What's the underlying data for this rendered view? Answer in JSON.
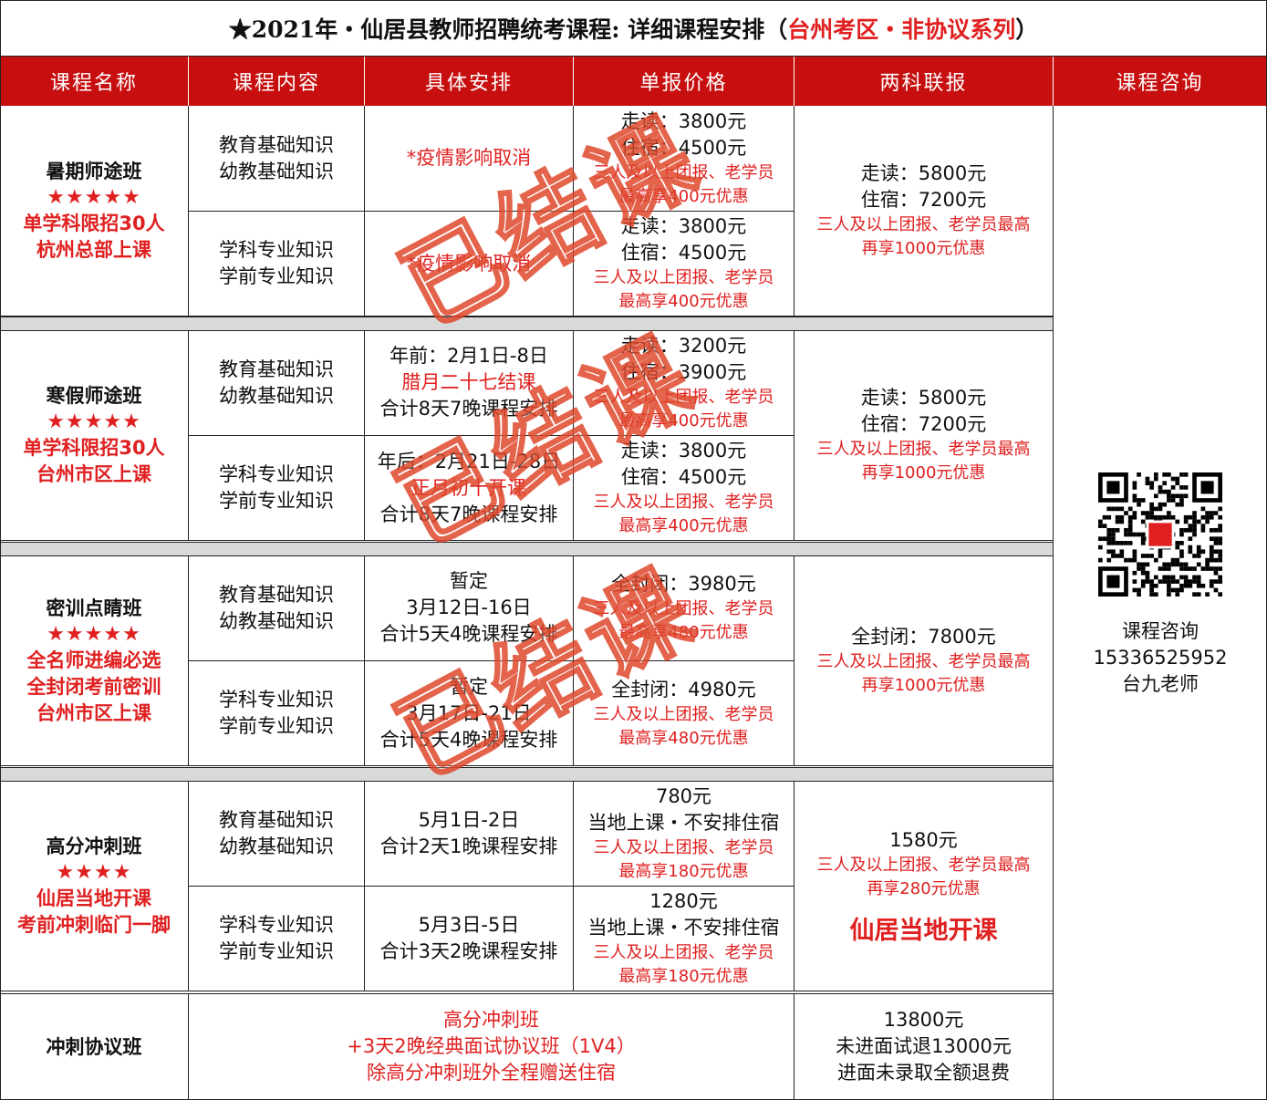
{
  "title": {
    "prefix": "★2021年・仙居县教师招聘统考课程:  详细课程安排（",
    "highlight": "台州考区・非协议系列",
    "suffix": "）"
  },
  "headers": [
    "课程名称",
    "课程内容",
    "具体安排",
    "单报价格",
    "两科联报",
    "课程咨询"
  ],
  "stamp_text": "已结课",
  "sections": [
    {
      "name": "暑期师途班",
      "stars": "★★★★★",
      "notes": [
        "单学科限招30人",
        "杭州总部上课"
      ],
      "rows": [
        {
          "content": [
            "教育基础知识",
            "幼教基础知识"
          ],
          "schedule": [
            {
              "t": "*疫情影响取消",
              "red": true
            }
          ],
          "price": [
            {
              "t": "走读：3800元"
            },
            {
              "t": "住宿：4500元"
            },
            {
              "t": "三人及以上团报、老学员",
              "red": true,
              "sm": true
            },
            {
              "t": "最高享400元优惠",
              "red": true,
              "sm": true
            }
          ]
        },
        {
          "content": [
            "学科专业知识",
            "学前专业知识"
          ],
          "schedule": [
            {
              "t": "*疫情影响取消",
              "red": true
            }
          ],
          "price": [
            {
              "t": "走读：3800元"
            },
            {
              "t": "住宿：4500元"
            },
            {
              "t": "三人及以上团报、老学员",
              "red": true,
              "sm": true
            },
            {
              "t": "最高享400元优惠",
              "red": true,
              "sm": true
            }
          ]
        }
      ],
      "combo": [
        {
          "t": "走读：5800元"
        },
        {
          "t": "住宿：7200元"
        },
        {
          "t": "三人及以上团报、老学员最高",
          "red": true,
          "sm": true
        },
        {
          "t": "再享1000元优惠",
          "red": true,
          "sm": true
        }
      ]
    },
    {
      "name": "寒假师途班",
      "stars": "★★★★★",
      "notes": [
        "单学科限招30人",
        "台州市区上课"
      ],
      "rows": [
        {
          "content": [
            "教育基础知识",
            "幼教基础知识"
          ],
          "schedule": [
            {
              "t": "年前：2月1日-8日"
            },
            {
              "t": "腊月二十七结课",
              "red": true
            },
            {
              "t": "合计8天7晚课程安排"
            }
          ],
          "price": [
            {
              "t": "走读：3200元"
            },
            {
              "t": "住宿：3900元"
            },
            {
              "t": "三人及以上团报、老学员",
              "red": true,
              "sm": true
            },
            {
              "t": "最高享400元优惠",
              "red": true,
              "sm": true
            }
          ]
        },
        {
          "content": [
            "学科专业知识",
            "学前专业知识"
          ],
          "schedule": [
            {
              "t": "年后：2月21日-28日"
            },
            {
              "t": "正月初十开课",
              "red": true
            },
            {
              "t": "合计8天7晚课程安排"
            }
          ],
          "price": [
            {
              "t": "走读：3800元"
            },
            {
              "t": "住宿：4500元"
            },
            {
              "t": "三人及以上团报、老学员",
              "red": true,
              "sm": true
            },
            {
              "t": "最高享400元优惠",
              "red": true,
              "sm": true
            }
          ]
        }
      ],
      "combo": [
        {
          "t": "走读：5800元"
        },
        {
          "t": "住宿：7200元"
        },
        {
          "t": "三人及以上团报、老学员最高",
          "red": true,
          "sm": true
        },
        {
          "t": "再享1000元优惠",
          "red": true,
          "sm": true
        }
      ]
    },
    {
      "name": "密训点睛班",
      "stars": "★★★★★",
      "notes": [
        "全名师进编必选",
        "全封闭考前密训",
        "台州市区上课"
      ],
      "rows": [
        {
          "content": [
            "教育基础知识",
            "幼教基础知识"
          ],
          "schedule": [
            {
              "t": "暂定"
            },
            {
              "t": "3月12日-16日"
            },
            {
              "t": "合计5天4晚课程安排"
            }
          ],
          "price": [
            {
              "t": "全封闭：3980元"
            },
            {
              "t": "三人及以上团报、老学员",
              "red": true,
              "sm": true
            },
            {
              "t": "最高享480元优惠",
              "red": true,
              "sm": true
            }
          ]
        },
        {
          "content": [
            "学科专业知识",
            "学前专业知识"
          ],
          "schedule": [
            {
              "t": "暂定"
            },
            {
              "t": "3月17日-21日"
            },
            {
              "t": "合计5天4晚课程安排"
            }
          ],
          "price": [
            {
              "t": "全封闭：4980元"
            },
            {
              "t": "三人及以上团报、老学员",
              "red": true,
              "sm": true
            },
            {
              "t": "最高享480元优惠",
              "red": true,
              "sm": true
            }
          ]
        }
      ],
      "combo": [
        {
          "t": "全封闭：7800元"
        },
        {
          "t": "三人及以上团报、老学员最高",
          "red": true,
          "sm": true
        },
        {
          "t": "再享1000元优惠",
          "red": true,
          "sm": true
        }
      ]
    },
    {
      "name": "高分冲刺班",
      "stars": "★★★★",
      "notes": [
        "仙居当地开课",
        "考前冲刺临门一脚"
      ],
      "rows": [
        {
          "content": [
            "教育基础知识",
            "幼教基础知识"
          ],
          "schedule": [
            {
              "t": "5月1日-2日"
            },
            {
              "t": "合计2天1晚课程安排"
            }
          ],
          "price": [
            {
              "t": "780元"
            },
            {
              "t": "当地上课・不安排住宿"
            },
            {
              "t": "三人及以上团报、老学员",
              "red": true,
              "sm": true
            },
            {
              "t": "最高享180元优惠",
              "red": true,
              "sm": true
            }
          ]
        },
        {
          "content": [
            "学科专业知识",
            "学前专业知识"
          ],
          "schedule": [
            {
              "t": "5月3日-5日"
            },
            {
              "t": "合计3天2晚课程安排"
            }
          ],
          "price": [
            {
              "t": "1280元"
            },
            {
              "t": "当地上课・不安排住宿"
            },
            {
              "t": "三人及以上团报、老学员",
              "red": true,
              "sm": true
            },
            {
              "t": "最高享180元优惠",
              "red": true,
              "sm": true
            }
          ]
        }
      ],
      "combo": [
        {
          "t": "1580元"
        },
        {
          "t": "三人及以上团报、老学员最高",
          "red": true,
          "sm": true
        },
        {
          "t": "再享280元优惠",
          "red": true,
          "sm": true
        },
        {
          "t": "仙居当地开课",
          "big": true
        }
      ]
    }
  ],
  "protocol": {
    "name": "冲刺协议班",
    "desc": [
      "高分冲刺班",
      "+3天2晚经典面试协议班（1V4）",
      "除高分冲刺班外全程赠送住宿"
    ],
    "price": [
      "13800元",
      "未进面试退13000元",
      "进面未录取全额退费"
    ]
  },
  "consult": {
    "lines": [
      "课程咨询",
      "15336525952",
      "台九老师"
    ],
    "qr_badge_icon": "brand-logo-icon"
  },
  "colors": {
    "header_bg": "#c80f0f",
    "accent_red": "#e02020",
    "stamp": "#e85a32",
    "divider_gray": "#d9d9d9"
  }
}
